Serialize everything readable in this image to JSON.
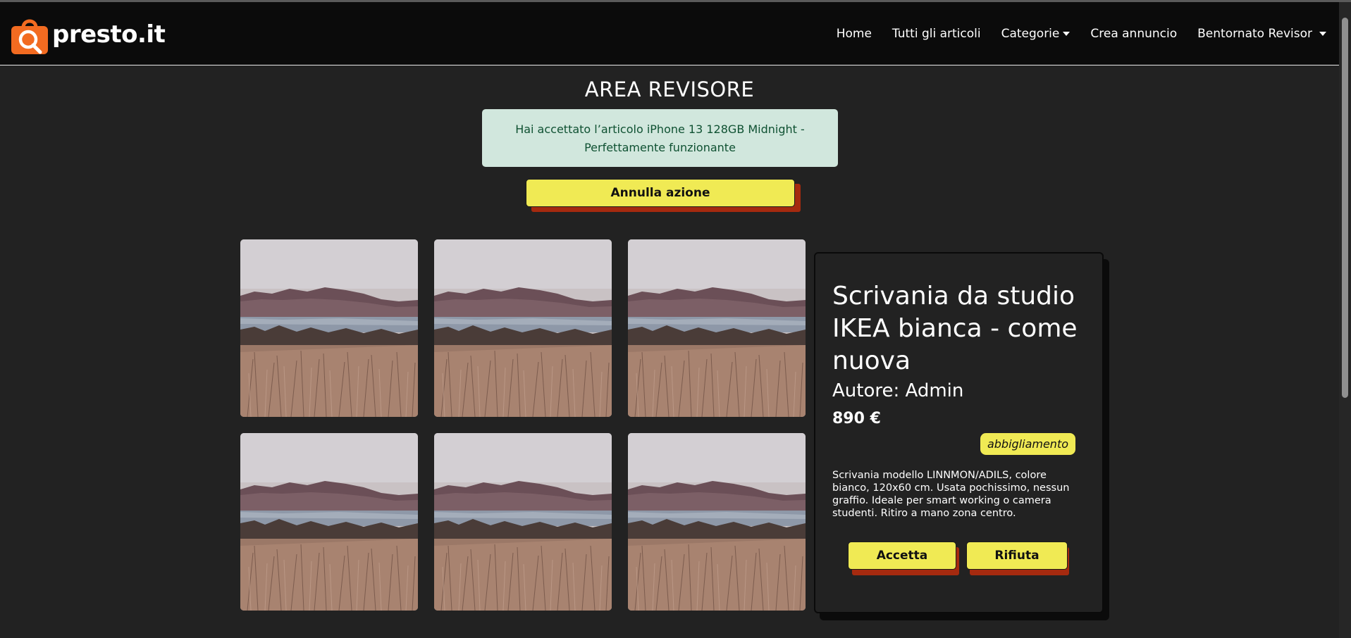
{
  "navbar": {
    "brand": "presto.it",
    "links": [
      {
        "label": "Home"
      },
      {
        "label": "Tutti gli articoli"
      },
      {
        "label": "Categorie"
      },
      {
        "label": "Crea annuncio"
      },
      {
        "label": "Bentornato Revisor"
      }
    ]
  },
  "page": {
    "title": "AREA REVISORE",
    "alert": "Hai accettato l’articolo iPhone 13 128GB Midnight - Perfettamente funzionante",
    "undo_label": "Annulla azione"
  },
  "gallery": {
    "image_count": 6
  },
  "article": {
    "title": "Scrivania da studio IKEA bianca - come nuova",
    "author": "Autore: Admin",
    "price": "890 €",
    "category": "abbigliamento",
    "description": "Scrivania modello LINNMON/ADILS, colore bianco, 120x60 cm. Usata pochissimo, nessun graffio. Ideale per smart working o camera studenti. Ritiro a mano zona centro.",
    "accept_label": "Accetta",
    "reject_label": "Rifiuta"
  },
  "colors": {
    "accent_yellow": "#f0ea54",
    "shadow_red": "#a52a0f",
    "brand_orange": "#f26b21",
    "alert_bg": "#d1e7dd",
    "alert_text": "#0f5132"
  },
  "icons": {
    "brand": "shopping-bag-search-icon"
  }
}
